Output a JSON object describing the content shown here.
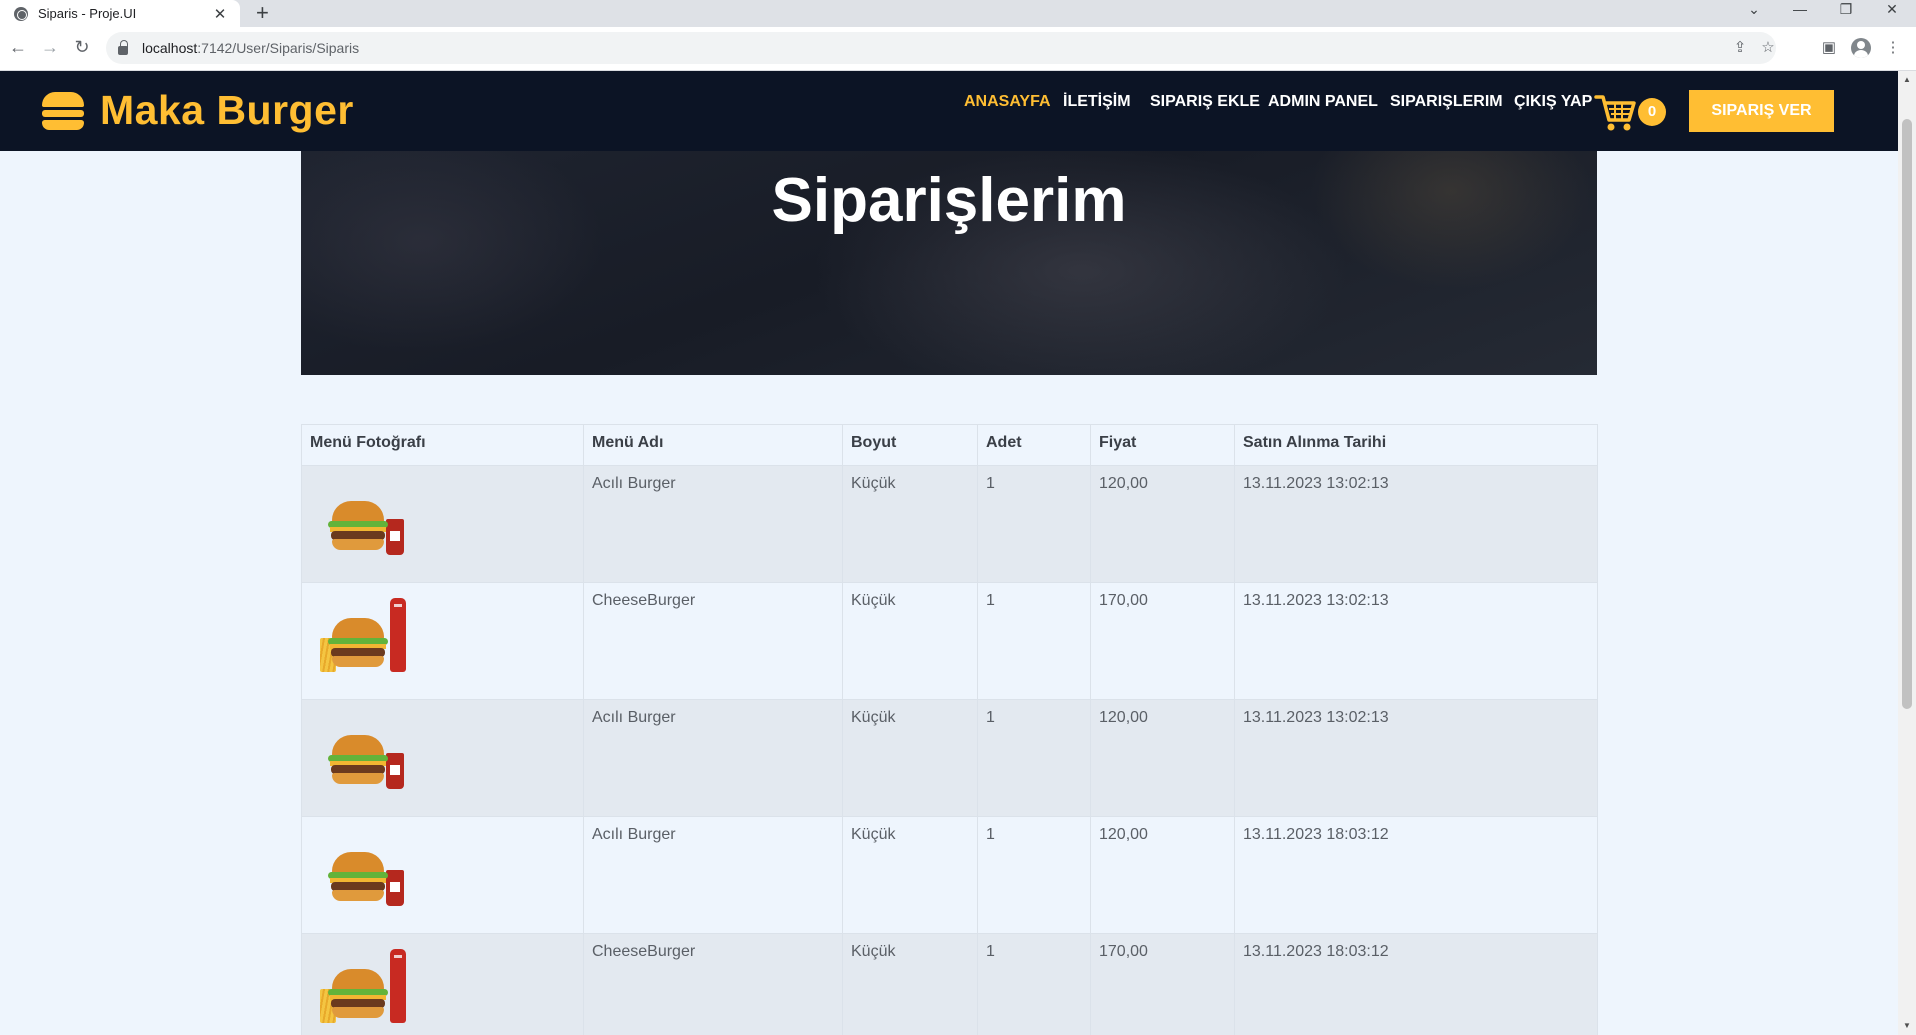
{
  "browser": {
    "tab_title": "Siparis - Proje.UI",
    "url_host": "localhost",
    "url_path": ":7142/User/Siparis/Siparis"
  },
  "site": {
    "brand": "Maka Burger",
    "nav": [
      "ANASAYFA",
      "İLETİŞİM",
      "SIPARIŞ EKLE",
      "ADMIN PANEL",
      "SIPARIŞLERIM",
      "ÇIKIŞ YAP"
    ],
    "active_nav": "ANASAYFA",
    "cart_count": "0",
    "order_button": "SIPARIŞ VER",
    "accent_color": "#ffbe33",
    "header_color": "#0c1425"
  },
  "hero": {
    "title": "Siparişlerim"
  },
  "table": {
    "headers": [
      "Menü Fotoğrafı",
      "Menü Adı",
      "Boyut",
      "Adet",
      "Fiyat",
      "Satın Alınma Tarihi"
    ],
    "rows": [
      {
        "image": "burger-drink-icon",
        "menu": "Acılı Burger",
        "size": "Küçük",
        "qty": "1",
        "price": "120,00",
        "date": "13.11.2023 13:02:13"
      },
      {
        "image": "cheeseburger-menu-icon",
        "menu": "CheeseBurger",
        "size": "Küçük",
        "qty": "1",
        "price": "170,00",
        "date": "13.11.2023 13:02:13"
      },
      {
        "image": "burger-drink-icon",
        "menu": "Acılı Burger",
        "size": "Küçük",
        "qty": "1",
        "price": "120,00",
        "date": "13.11.2023 13:02:13"
      },
      {
        "image": "burger-drink-icon",
        "menu": "Acılı Burger",
        "size": "Küçük",
        "qty": "1",
        "price": "120,00",
        "date": "13.11.2023 18:03:12"
      },
      {
        "image": "cheeseburger-menu-icon",
        "menu": "CheeseBurger",
        "size": "Küçük",
        "qty": "1",
        "price": "170,00",
        "date": "13.11.2023 18:03:12"
      }
    ]
  }
}
